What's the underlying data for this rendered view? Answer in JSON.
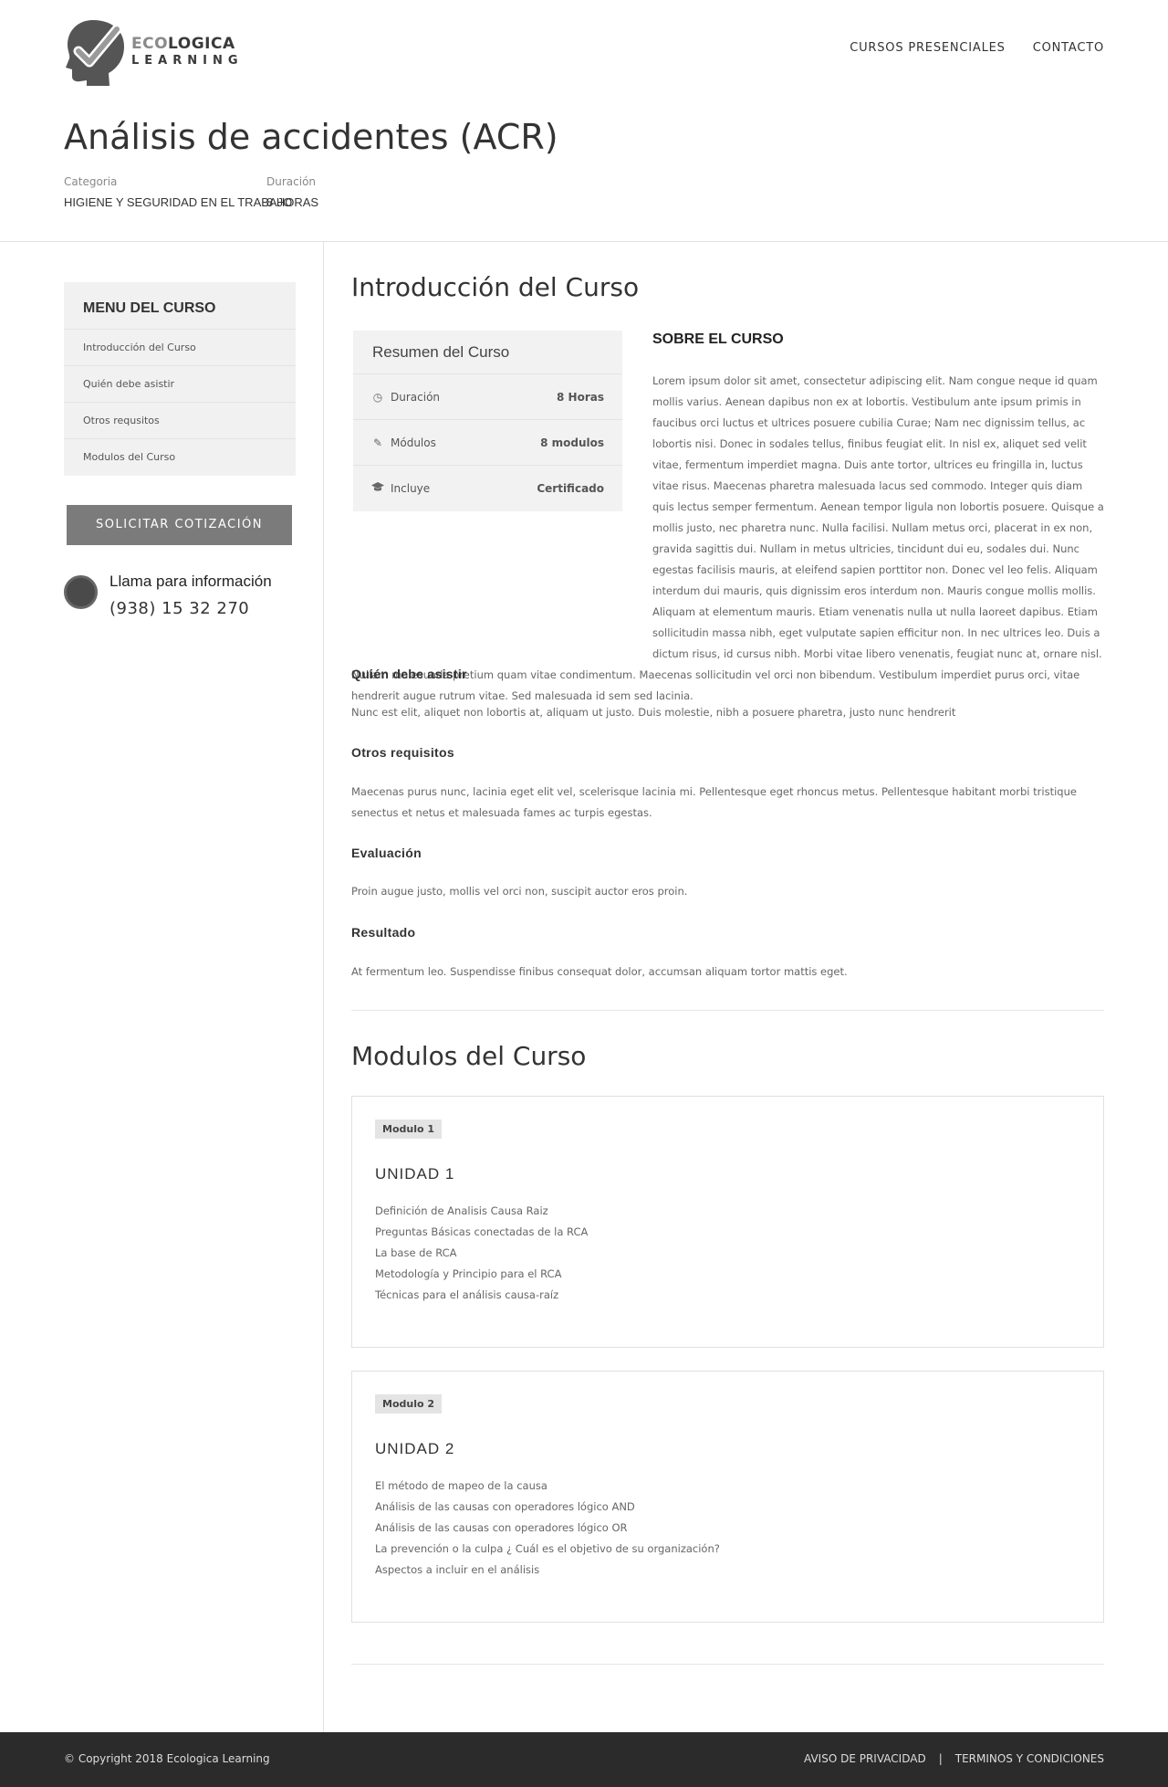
{
  "brand": {
    "name_part1": "ECO",
    "name_part2": "LOGICA",
    "name_line2": "LEARNING"
  },
  "nav": {
    "items": [
      "CURSOS PRESENCIALES",
      "CONTACTO"
    ]
  },
  "course": {
    "title": "Análisis de accidentes (ACR)",
    "category_label": "Categoria",
    "category_value": "HIGIENE Y SEGURIDAD EN EL TRABAJO",
    "duration_label": "Duración",
    "duration_value": "8 HORAS"
  },
  "sidebar": {
    "menu_title": "MENU DEL CURSO",
    "items": [
      {
        "label": "Introducción del Curso"
      },
      {
        "label": "Quién debe asistir"
      },
      {
        "label": "Otros requsitos"
      },
      {
        "label": "Modulos del Curso"
      }
    ],
    "quote_button": "SOLICITAR COTIZACIÓN",
    "phone_label": "Llama para información",
    "phone_number": "(938) 15 32 270"
  },
  "intro": {
    "heading": "Introducción del Curso",
    "summary": {
      "title": "Resumen del Curso",
      "rows": [
        {
          "icon": "clock-icon",
          "label": "Duración",
          "value": "8 Horas"
        },
        {
          "icon": "edit-icon",
          "label": "Módulos",
          "value": "8 modulos"
        },
        {
          "icon": "graduation-cap-icon",
          "label": "Incluye",
          "value": "Certificado"
        }
      ]
    },
    "about_title": "SOBRE EL CURSO",
    "about_text": "Lorem ipsum dolor sit amet, consectetur adipiscing elit. Nam congue neque id quam mollis varius. Aenean dapibus non ex at lobortis. Vestibulum ante ipsum primis in faucibus orci luctus et ultrices posuere cubilia Curae; Nam nec dignissim tellus, ac lobortis nisi. Donec in sodales tellus, finibus feugiat elit. In nisl ex, aliquet sed velit vitae, fermentum imperdiet magna. Duis ante tortor, ultrices eu fringilla in, luctus vitae risus. Maecenas pharetra malesuada lacus sed commodo. Integer quis diam quis lectus semper fermentum. Aenean tempor ligula non lobortis posuere. Quisque a mollis justo, nec pharetra nunc. Nulla facilisi. Nullam metus orci, placerat in ex non, gravida sagittis dui. Nullam in metus ultricies, tincidunt dui eu, sodales dui. Nunc egestas facilisis mauris, at eleifend sapien porttitor non. Donec vel leo felis. Aliquam interdum dui mauris, quis dignissim eros interdum non. Mauris congue mollis mollis. Aliquam at elementum mauris. Etiam venenatis nulla ut nulla laoreet dapibus. Etiam sollicitudin massa nibh, eget vulputate sapien efficitur non. In nec ultrices leo. Duis a dictum risus, id cursus nibh. Morbi vitae libero venenatis, feugiat nunc at, ornare nisl. Nullam malesuada pretium quam vitae condimentum. Maecenas sollicitudin vel orci non bibendum. Vestibulum imperdiet purus orci, vitae hendrerit augue rutrum vitae. Sed malesuada id sem sed lacinia."
  },
  "sections": [
    {
      "title": "Quién debe asistir",
      "text": "Nunc est elit, aliquet non lobortis at, aliquam ut justo. Duis molestie, nibh a posuere pharetra, justo nunc hendrerit"
    },
    {
      "title": "Otros requisitos",
      "text": "Maecenas purus nunc, lacinia eget elit vel, scelerisque lacinia mi. Pellentesque eget rhoncus metus. Pellentesque habitant morbi tristique senectus et netus et malesuada fames ac turpis egestas."
    },
    {
      "title": "Evaluación",
      "text": "Proin augue justo, mollis vel orci non, suscipit auctor eros proin."
    },
    {
      "title": "Resultado",
      "text": "At fermentum leo. Suspendisse finibus consequat dolor, accumsan aliquam tortor mattis eget."
    }
  ],
  "modules": {
    "heading": "Modulos del Curso",
    "items": [
      {
        "badge": "Modulo 1",
        "title": "UNIDAD 1",
        "topics": [
          "Definición de Analisis Causa Raiz",
          "Preguntas Básicas conectadas de la RCA",
          "La base de RCA",
          "Metodología y Principio para el RCA",
          "Técnicas para el análisis causa-raíz"
        ]
      },
      {
        "badge": "Modulo 2",
        "title": "UNIDAD 2",
        "topics": [
          "El método de mapeo de la causa",
          "Análisis de las causas con operadores lógico AND",
          "Análisis de las causas con operadores lógico OR",
          "La prevención o la culpa ¿ Cuál es el objetivo de su organización?",
          "Aspectos a incluir en el análisis"
        ]
      }
    ]
  },
  "footer": {
    "copyright": "© Copyright 2018 Ecologica Learning",
    "links": [
      "AVISO DE PRIVACIDAD",
      "TERMINOS Y CONDICIONES"
    ],
    "separator": "|"
  },
  "colors": {
    "button_bg": "#7b7b7b",
    "footer_bg": "#2b2b2b",
    "sidebar_bg": "#f1f1f1"
  }
}
